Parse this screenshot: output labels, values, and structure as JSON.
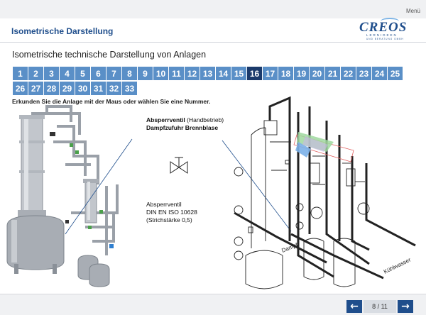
{
  "topbar": {
    "menu_label": "Menü"
  },
  "header": {
    "title": "Isometrische Darstellung"
  },
  "logo": {
    "word": "CREOS",
    "line1": "LERNIDEEN",
    "line2": "UND BERATUNG GMBH"
  },
  "subtitle": "Isometrische technische Darstellung von Anlagen",
  "number_buttons": {
    "row1": [
      "1",
      "2",
      "3",
      "4",
      "5",
      "6",
      "7",
      "8",
      "9",
      "10",
      "11",
      "12",
      "13",
      "14",
      "15",
      "16",
      "17",
      "18",
      "19",
      "20",
      "21",
      "22",
      "23",
      "24",
      "25"
    ],
    "row2": [
      "26",
      "27",
      "28",
      "29",
      "30",
      "31",
      "32",
      "33"
    ],
    "active": "16"
  },
  "instruction": "Erkunden Sie die Anlage mit der Maus oder wählen Sie eine Nummer.",
  "callout_top": {
    "title": "Absperrventil",
    "title_suffix": " (Handbetrieb)",
    "line2": "Dampfzufuhr Brennblase"
  },
  "callout_bottom": {
    "line1": "Absperrventil",
    "line2": "DIN EN ISO 10628",
    "line3": "(Strichstärke 0,5)"
  },
  "drawing_labels": {
    "steam": "Dampf",
    "cooling": "Kühlwasser"
  },
  "footer": {
    "page_indicator": "8 / 11",
    "prev_icon": "arrow-left-icon",
    "next_icon": "arrow-right-icon"
  },
  "colors": {
    "primary": "#1f4e8c",
    "button": "#5a8fc7",
    "active": "#1b3a6b"
  }
}
